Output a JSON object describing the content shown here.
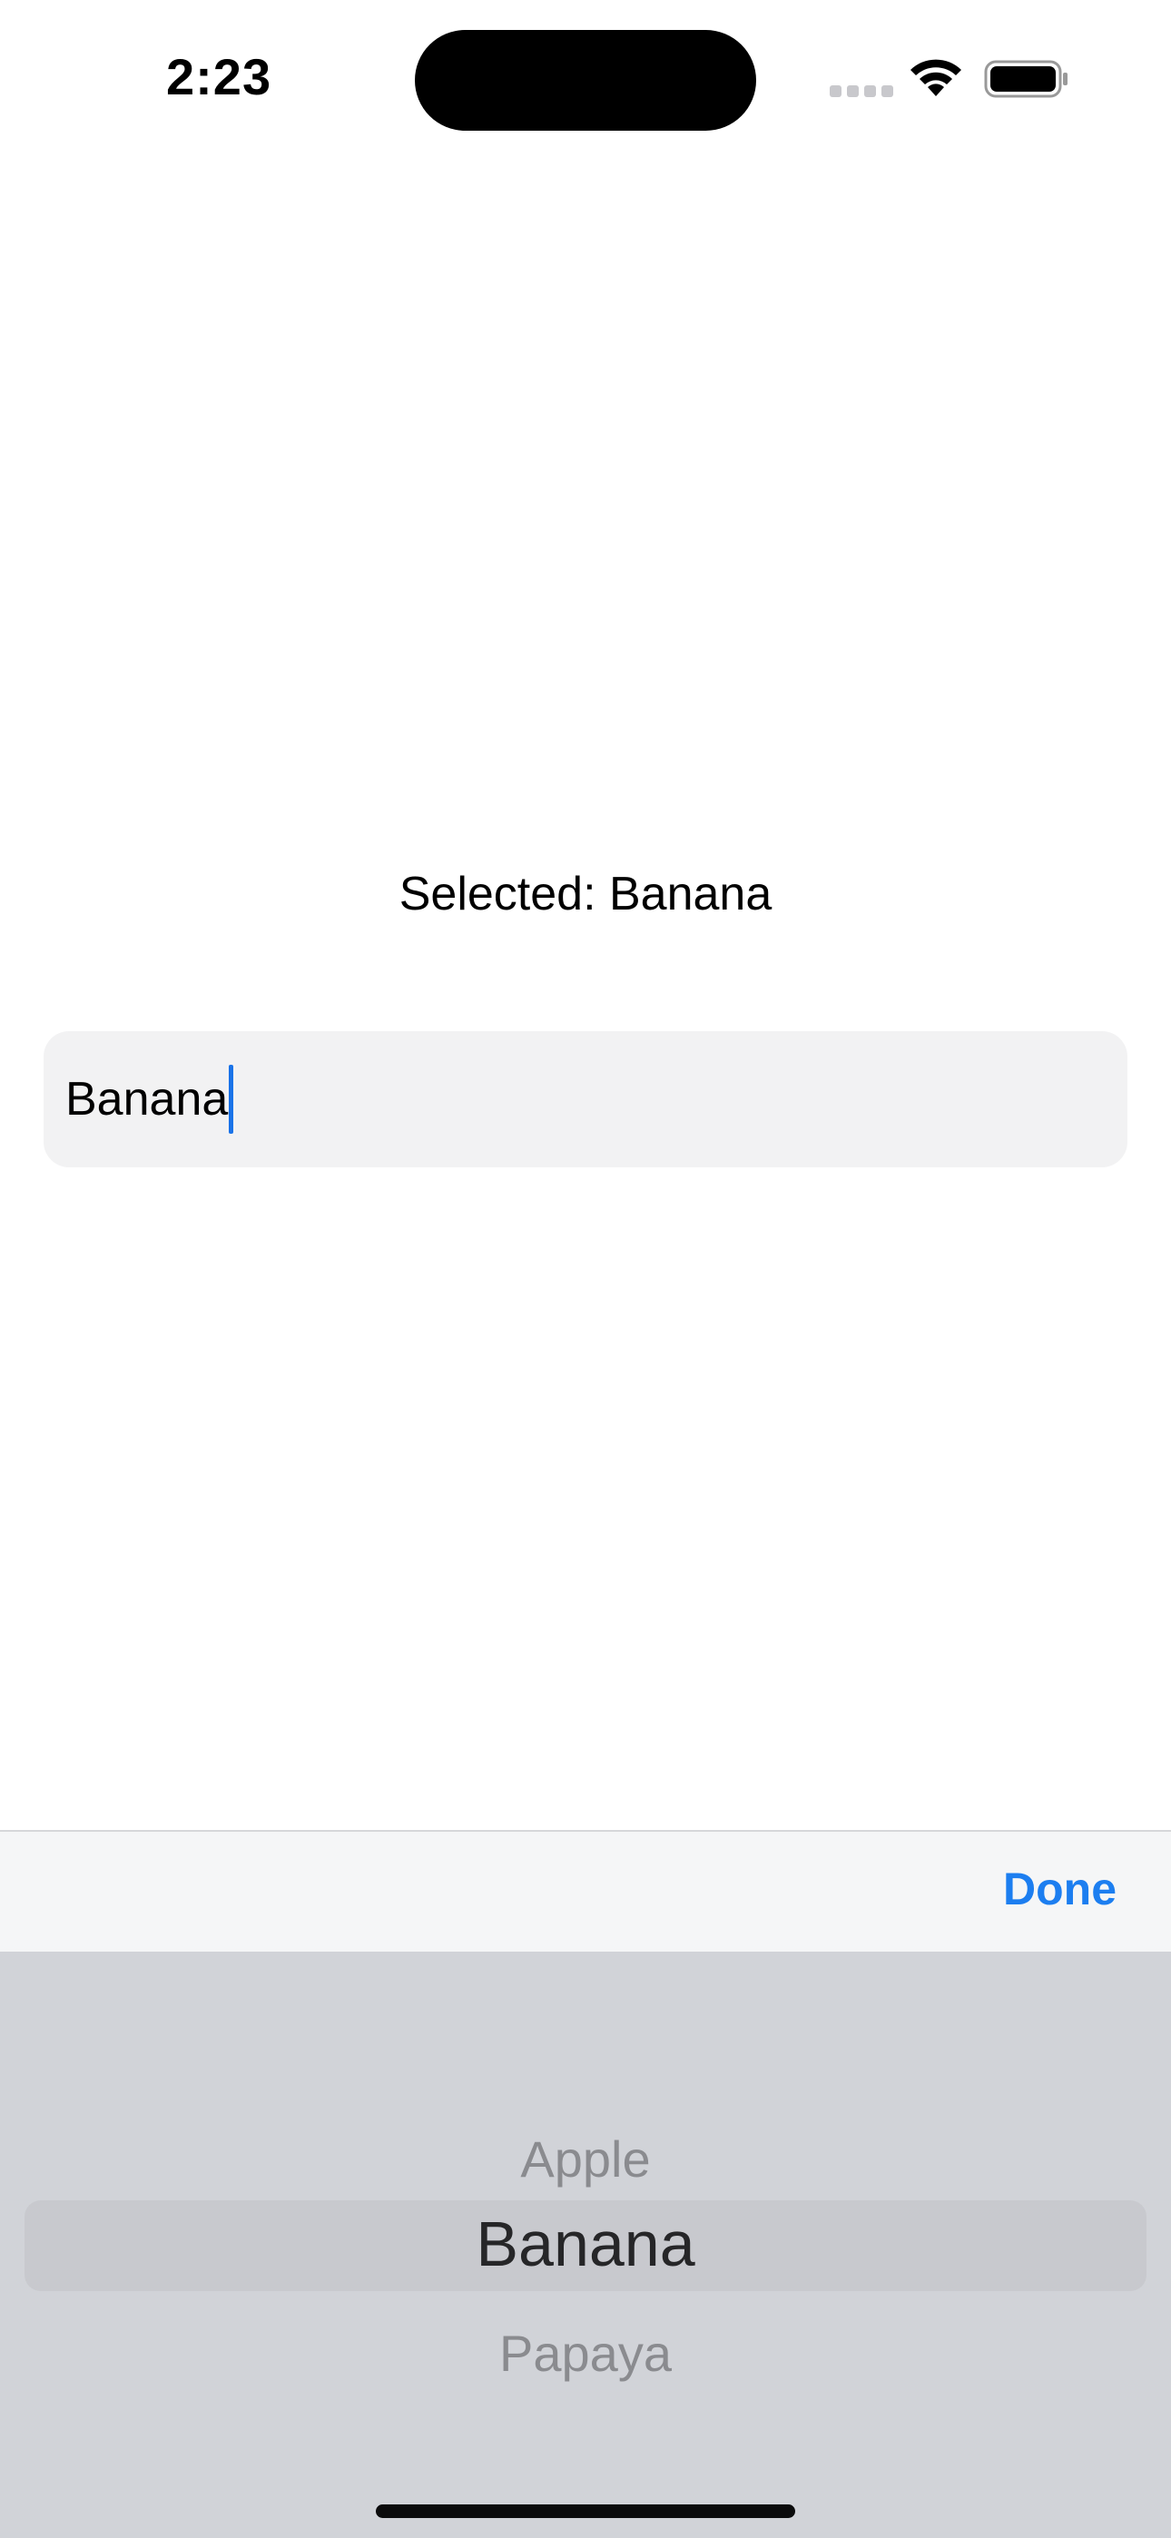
{
  "status_bar": {
    "time": "2:23",
    "icons": [
      "cellular-signal-icon",
      "wifi-icon",
      "battery-icon"
    ]
  },
  "main": {
    "selected_label": "Selected: Banana",
    "text_field": {
      "value": "Banana"
    }
  },
  "toolbar": {
    "done_label": "Done"
  },
  "picker": {
    "options": [
      "Apple",
      "Banana",
      "Papaya"
    ],
    "selected_index": 1,
    "rows": {
      "prev": "Apple",
      "current": "Banana",
      "next": "Papaya"
    }
  },
  "colors": {
    "accent": "#1c7ef0",
    "caret": "#1a73e8",
    "picker_background": "#d1d3d8",
    "toolbar_background": "#f5f6f7",
    "field_background": "#f2f2f3"
  }
}
